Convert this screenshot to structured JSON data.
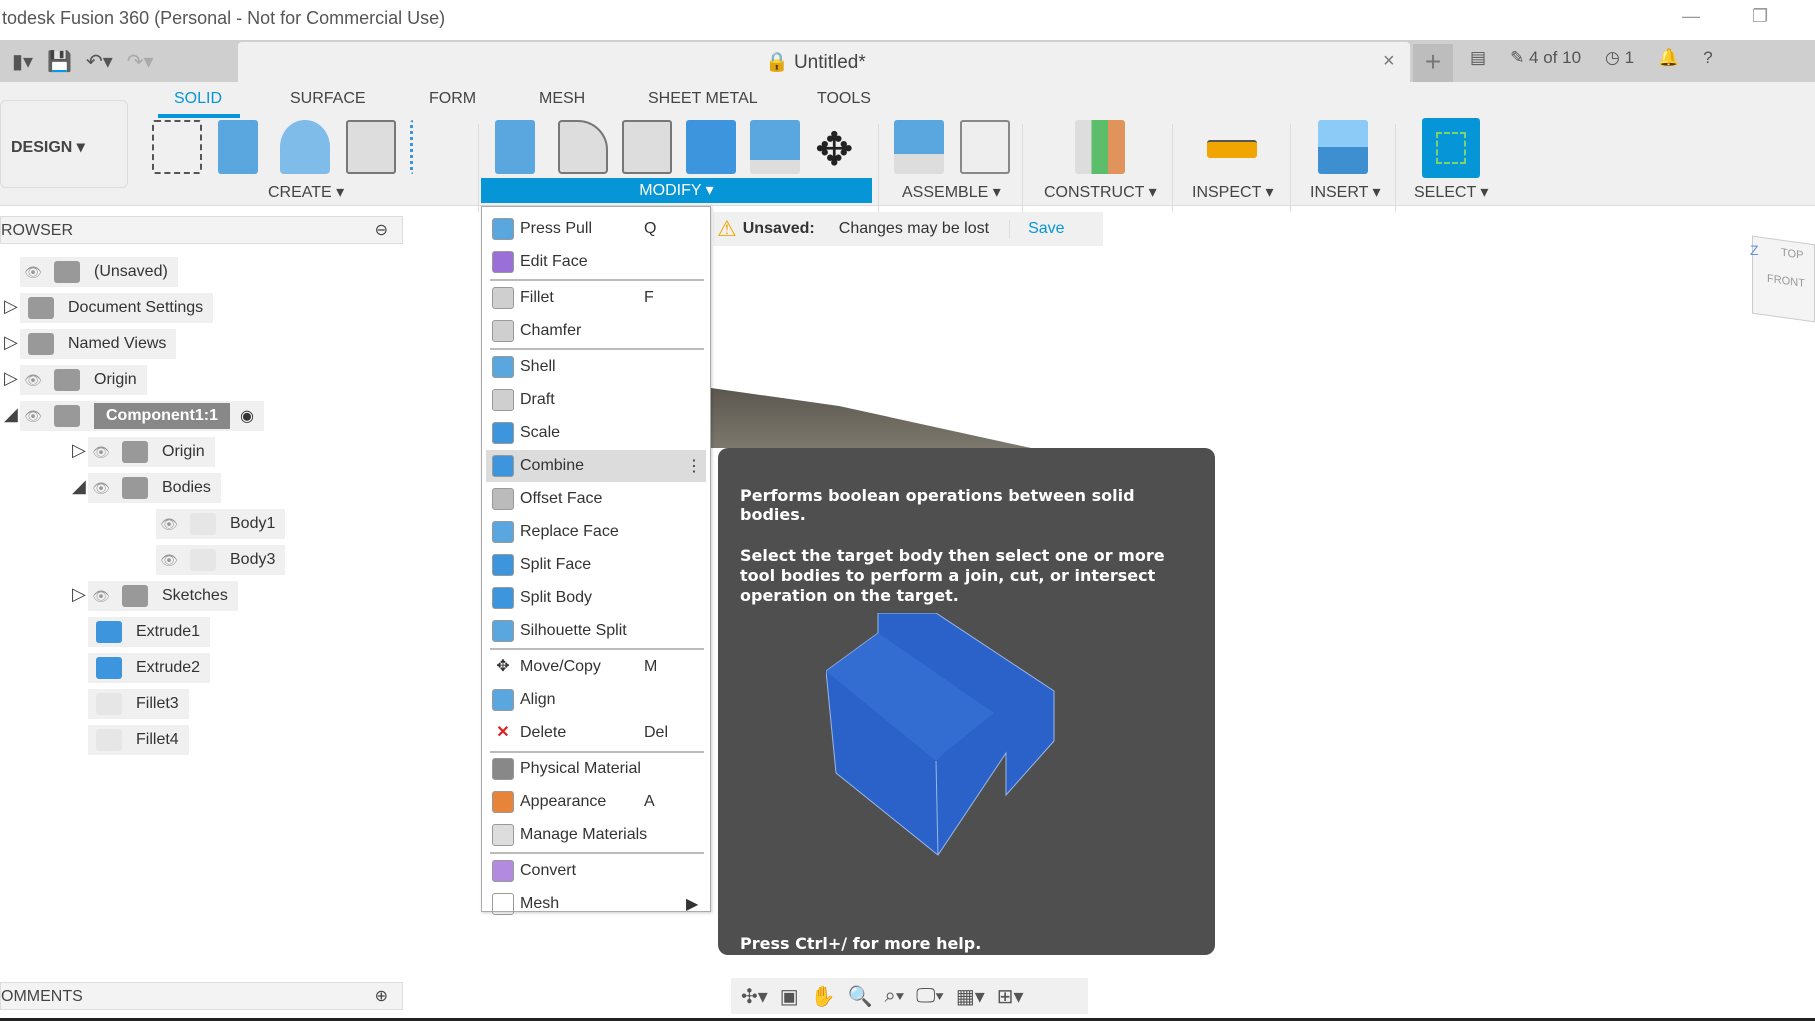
{
  "window": {
    "title": "todesk Fusion 360 (Personal - Not for Commercial Use)",
    "minimize": "—",
    "restore": "❐"
  },
  "doc": {
    "title": "Untitled*",
    "close": "×",
    "new_tab": "+",
    "jobs": "4 of 10",
    "clock": "1"
  },
  "ribbon": {
    "workspace": "DESIGN ▾",
    "tabs": [
      "SOLID",
      "SURFACE",
      "FORM",
      "MESH",
      "SHEET METAL",
      "TOOLS"
    ],
    "groups": [
      "CREATE ▾",
      "MODIFY ▾",
      "ASSEMBLE ▾",
      "CONSTRUCT ▾",
      "INSPECT ▾",
      "INSERT ▾",
      "SELECT ▾"
    ]
  },
  "browser": {
    "title": "ROWSER",
    "items": [
      {
        "label": "(Unsaved)",
        "level": 0,
        "expander": "",
        "eye": true
      },
      {
        "label": "Document Settings",
        "level": 0,
        "expander": "▷",
        "eye": false
      },
      {
        "label": "Named Views",
        "level": 0,
        "expander": "▷",
        "eye": false
      },
      {
        "label": "Origin",
        "level": 0,
        "expander": "▷",
        "eye": true
      },
      {
        "label": "Component1:1",
        "level": 0,
        "expander": "◢",
        "eye": true
      },
      {
        "label": "Origin",
        "level": 1,
        "expander": "▷",
        "eye": true
      },
      {
        "label": "Bodies",
        "level": 1,
        "expander": "◢",
        "eye": true
      },
      {
        "label": "Body1",
        "level": 2,
        "expander": "",
        "eye": true
      },
      {
        "label": "Body3",
        "level": 2,
        "expander": "",
        "eye": true
      },
      {
        "label": "Sketches",
        "level": 1,
        "expander": "▷",
        "eye": true
      },
      {
        "label": "Extrude1",
        "level": 1,
        "expander": "",
        "eye": false
      },
      {
        "label": "Extrude2",
        "level": 1,
        "expander": "",
        "eye": false
      },
      {
        "label": "Fillet3",
        "level": 1,
        "expander": "",
        "eye": false
      },
      {
        "label": "Fillet4",
        "level": 1,
        "expander": "",
        "eye": false
      }
    ]
  },
  "menu": {
    "items": [
      {
        "label": "Press Pull",
        "shortcut": "Q",
        "color": "#5aa7e0"
      },
      {
        "label": "Edit Face",
        "shortcut": "",
        "color": "#9b6fd8",
        "sep_after": true
      },
      {
        "label": "Fillet",
        "shortcut": "F",
        "color": "#cfcfcf"
      },
      {
        "label": "Chamfer",
        "shortcut": "",
        "color": "#cfcfcf",
        "sep_after": true
      },
      {
        "label": "Shell",
        "shortcut": "",
        "color": "#5aa7e0"
      },
      {
        "label": "Draft",
        "shortcut": "",
        "color": "#cfcfcf"
      },
      {
        "label": "Scale",
        "shortcut": "",
        "color": "#3d95dd"
      },
      {
        "label": "Combine",
        "shortcut": "⋮",
        "color": "#3d95dd",
        "highlight": true
      },
      {
        "label": "Offset Face",
        "shortcut": "",
        "color": "#bbb"
      },
      {
        "label": "Replace Face",
        "shortcut": "",
        "color": "#5aa7e0"
      },
      {
        "label": "Split Face",
        "shortcut": "",
        "color": "#3d95dd"
      },
      {
        "label": "Split Body",
        "shortcut": "",
        "color": "#3d95dd"
      },
      {
        "label": "Silhouette Split",
        "shortcut": "",
        "color": "#5aa7e0",
        "sep_after": true
      },
      {
        "label": "Move/Copy",
        "shortcut": "M",
        "color": "#fff"
      },
      {
        "label": "Align",
        "shortcut": "",
        "color": "#5aa7e0"
      },
      {
        "label": "Delete",
        "shortcut": "Del",
        "color": "#fff"
      },
      {
        "label": "Physical Material",
        "shortcut": "",
        "color": "#888",
        "sep_before": true
      },
      {
        "label": "Appearance",
        "shortcut": "A",
        "color": "#e8843a"
      },
      {
        "label": "Manage Materials",
        "shortcut": "",
        "color": "#ddd",
        "sep_after": true
      },
      {
        "label": "Convert",
        "shortcut": "",
        "color": "#b28be0"
      },
      {
        "label": "Mesh",
        "shortcut": "▶",
        "color": ""
      }
    ]
  },
  "notification": {
    "label": "Unsaved:",
    "message": "Changes may be lost",
    "action": "Save"
  },
  "tooltip": {
    "heading": "Performs boolean operations between solid bodies.",
    "body": "Select the target body then select one or more tool bodies to perform a join, cut, or intersect operation on the target.",
    "footer": "Press Ctrl+/ for more help."
  },
  "comments": {
    "title": "OMMENTS"
  },
  "viewcube": {
    "top": "TOP",
    "front": "FRONT",
    "axis": "Z"
  },
  "colors": {
    "accent": "#0696d7",
    "tooltip_bg": "#4f4f4f",
    "body_blue": "#2a62c9"
  }
}
